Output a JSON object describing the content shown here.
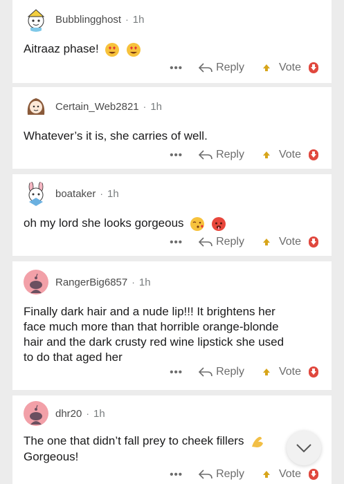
{
  "actions": {
    "more": "•••",
    "reply": "Reply",
    "vote": "Vote"
  },
  "comments": [
    {
      "username": "Bubblingghost",
      "time": "1h",
      "text": "Aitraaz phase!",
      "avatar": "snoo-avatar-yellow-hat"
    },
    {
      "username": "Certain_Web2821",
      "time": "1h",
      "text": "Whatever’s it is, she carries of well.",
      "avatar": "snoo-avatar-brown-hair"
    },
    {
      "username": "boataker",
      "time": "1h",
      "text": "oh my lord she looks gorgeous",
      "avatar": "snoo-avatar-bunny-costume"
    },
    {
      "username": "RangerBig6857",
      "time": "1h",
      "text_lines": [
        "Finally dark hair and a nude lip!!! It brightens her",
        "face much more than that horrible orange-blonde",
        "hair and the dark crusty red wine lipstick she used",
        "to do that aged her"
      ],
      "avatar": "default-snoo-pink"
    },
    {
      "username": "dhr20",
      "time": "1h",
      "text_lines": [
        "The one that didn’t fall prey to cheek fillers",
        "Gorgeous!"
      ],
      "avatar": "default-snoo-pink"
    }
  ],
  "colors": {
    "separator": "#ececec",
    "username": "#4a4a4a",
    "meta": "#787c7e",
    "upvote": "#d7a51b",
    "downvote": "#e0483e",
    "default_avatar": "#f2a0a8"
  },
  "icons": [
    "heart-eyes-emoji",
    "kissing-emoji",
    "hot-face-emoji",
    "flexed-arm-emoji",
    "reply-arrow-icon",
    "upvote-icon",
    "downvote-icon",
    "chevron-down-icon"
  ]
}
